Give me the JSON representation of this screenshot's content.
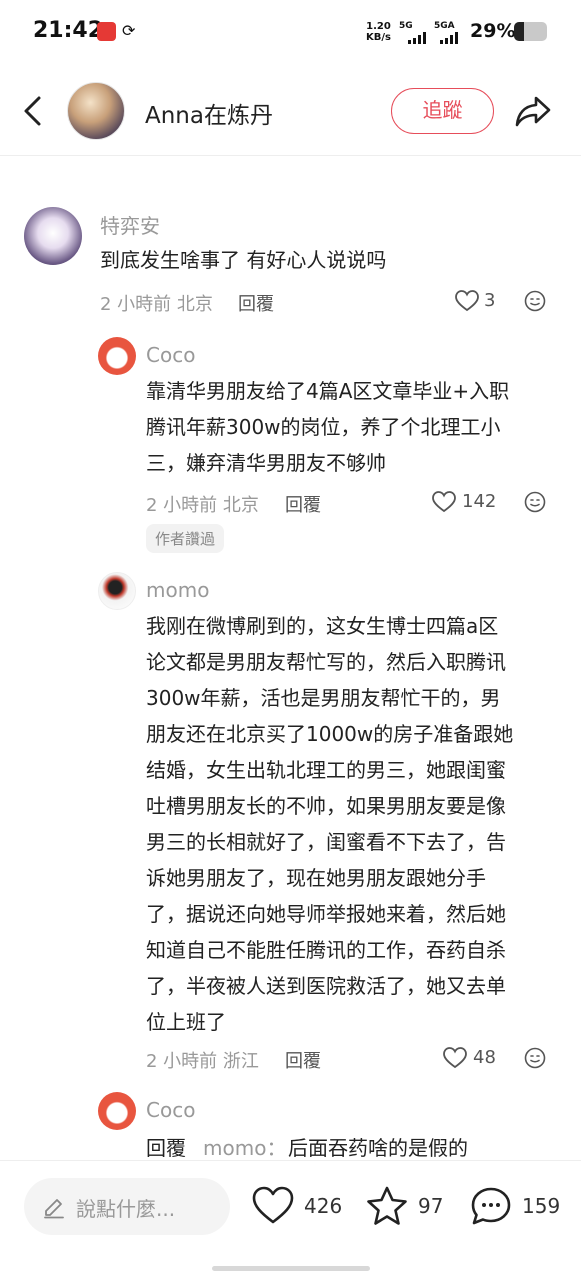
{
  "status_bar": {
    "time": "21:42",
    "speed_value": "1.20",
    "speed_unit": "KB/s",
    "net1": "5G",
    "net2": "5GA",
    "battery_percent": "29%",
    "battery_level": 0.29
  },
  "header": {
    "author_name": "Anna在炼丹",
    "follow_label": "追蹤"
  },
  "comments": [
    {
      "name": "特弈安",
      "text": "到底发生啥事了 有好心人说说吗",
      "meta": "2 小時前 北京",
      "reply_label": "回覆",
      "likes": "3"
    },
    {
      "name": "Coco",
      "text_lines": [
        "靠清华男朋友给了4篇A区文章毕业+入职",
        "腾讯年薪300w的岗位，养了个北理工小",
        "三，嫌弃清华男朋友不够帅"
      ],
      "meta": "2 小時前 北京",
      "reply_label": "回覆",
      "likes": "142",
      "tag": "作者讚過"
    },
    {
      "name": "momo",
      "text_lines": [
        "我刚在微博刷到的，这女生博士四篇a区",
        "论文都是男朋友帮忙写的，然后入职腾讯",
        "300w年薪，活也是男朋友帮忙干的，男",
        "朋友还在北京买了1000w的房子准备跟她",
        "结婚，女生出轨北理工的男三，她跟闺蜜",
        "吐槽男朋友长的不帅，如果男朋友要是像",
        "男三的长相就好了，闺蜜看不下去了，告",
        "诉她男朋友了，现在她男朋友跟她分手",
        "了，据说还向她导师举报她来着，然后她",
        "知道自己不能胜任腾讯的工作，吞药自杀",
        "了，半夜被人送到医院救活了，她又去单",
        "位上班了"
      ],
      "meta": "2 小時前 浙江",
      "reply_label": "回覆",
      "likes": "48"
    },
    {
      "name": "Coco",
      "reply_prefix": "回覆",
      "reply_to": "momo：",
      "text": "后面吞药啥的是假的"
    }
  ],
  "bottom_bar": {
    "input_placeholder": "說點什麼...",
    "likes": "426",
    "collects": "97",
    "comments": "159"
  }
}
